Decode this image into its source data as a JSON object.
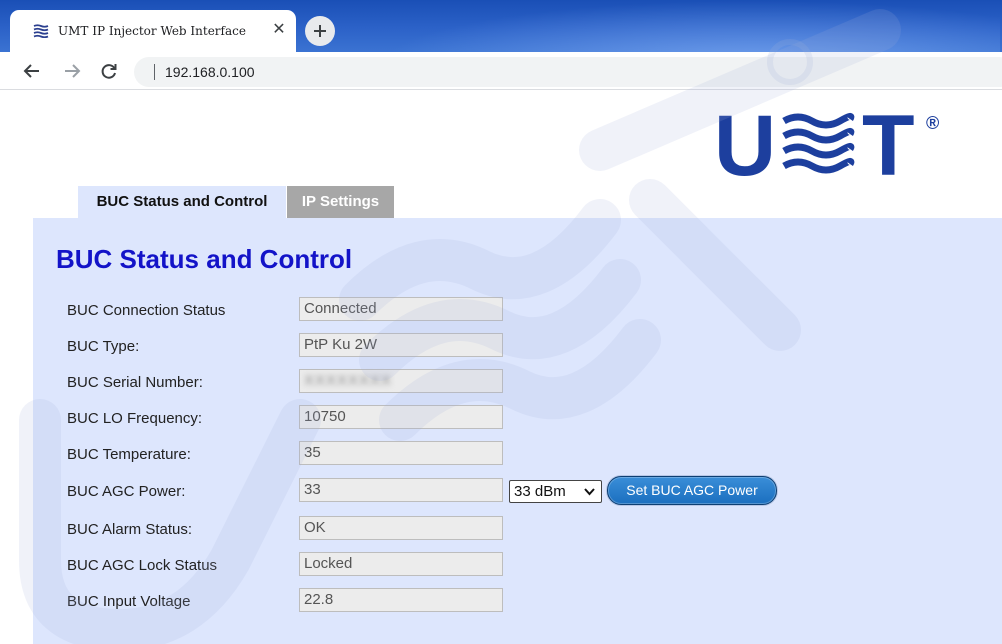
{
  "browser": {
    "tab_title": "UMT IP Injector Web Interface",
    "url": "192.168.0.100"
  },
  "logo": {
    "text": "UMT",
    "registered": "®"
  },
  "tabs": [
    {
      "label": "BUC Status and Control",
      "active": true
    },
    {
      "label": "IP Settings",
      "active": false
    }
  ],
  "panel": {
    "title": "BUC Status and Control",
    "rows": [
      {
        "label": "BUC Connection Status",
        "value": "Connected"
      },
      {
        "label": "BUC Type:",
        "value": "PtP Ku 2W"
      },
      {
        "label": "BUC Serial Number:",
        "value": "XXXXXXXX"
      },
      {
        "label": "BUC LO Frequency:",
        "value": "10750"
      },
      {
        "label": "BUC Temperature:",
        "value": "35"
      },
      {
        "label": "BUC AGC Power:",
        "value": "33"
      },
      {
        "label": "BUC Alarm Status:",
        "value": "OK"
      },
      {
        "label": "BUC AGC Lock Status",
        "value": "Locked"
      },
      {
        "label": "BUC Input Voltage",
        "value": "22.8"
      }
    ],
    "agc_select_value": "33 dBm",
    "agc_button_label": "Set BUC AGC Power"
  },
  "colors": {
    "panel_bg": "#dde6fd",
    "title": "#1313c8",
    "inactive_tab": "#a7a7a7",
    "button": "#1b6fbf",
    "logo": "#1d3f9e"
  },
  "icons": [
    "umt-favicon-icon",
    "close-icon",
    "plus-icon",
    "back-arrow-icon",
    "forward-arrow-icon",
    "reload-icon",
    "chevron-down-icon"
  ]
}
